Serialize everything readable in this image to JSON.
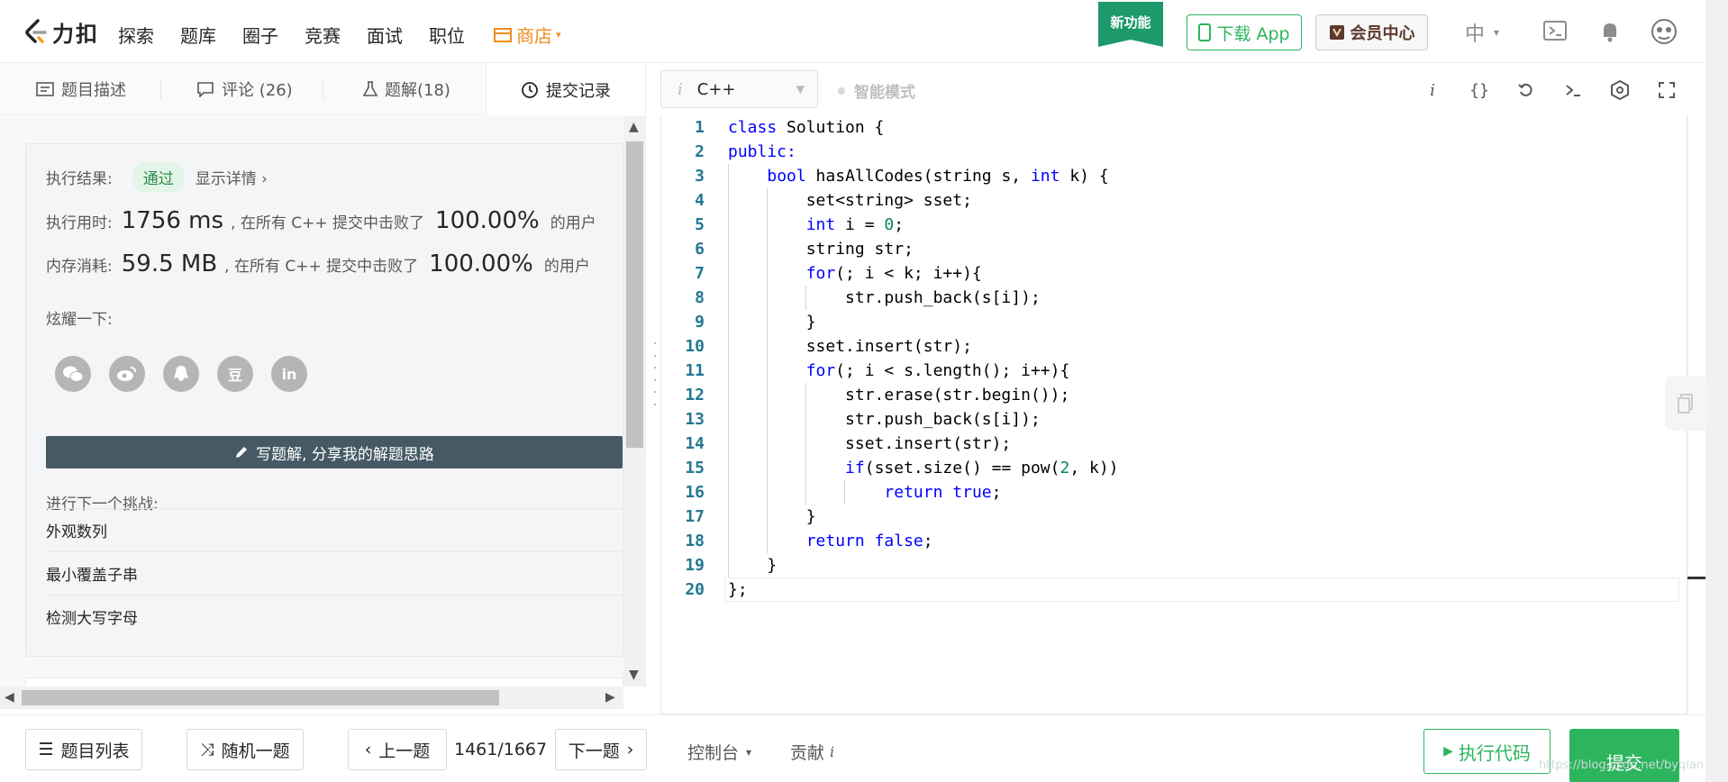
{
  "nav": {
    "logo_text": "力扣",
    "items": [
      "探索",
      "题库",
      "圈子",
      "竞赛",
      "面试",
      "职位"
    ],
    "store": "商店",
    "new_feature": "新功能",
    "download": "下载 App",
    "member": "会员中心",
    "lang": "中"
  },
  "left_tabs": {
    "description": "题目描述",
    "comments": "评论 (26)",
    "solutions": "题解(18)",
    "submissions": "提交记录"
  },
  "result": {
    "status_label": "执行结果:",
    "status": "通过",
    "detail_link": "显示详情 ›",
    "time_label": "执行用时:",
    "time_value": "1756 ms",
    "time_text": ", 在所有 C++ 提交中击败了",
    "time_pct": "100.00%",
    "time_suffix": "的用户",
    "mem_label": "内存消耗:",
    "mem_value": "59.5 MB",
    "mem_text": ", 在所有 C++ 提交中击败了",
    "mem_pct": "100.00%",
    "mem_suffix": "的用户",
    "share_label": "炫耀一下:",
    "share_douban": "豆",
    "share_linkedin": "in",
    "write_solution": "写题解, 分享我的解题思路",
    "next_label": "进行下一个挑战:",
    "next_items": [
      "外观数列",
      "最小覆盖子串",
      "检测大写字母"
    ]
  },
  "editor": {
    "language": "C++",
    "smart_mode": "智能模式",
    "code": [
      [
        [
          "Class ",
          ""
        ]
      ],
      [
        [
          "public:",
          "kw"
        ]
      ],
      [
        [
          "    ",
          ""
        ],
        [
          "bool",
          "kw"
        ],
        [
          " hasAllCodes(string s, ",
          ""
        ],
        [
          "int",
          "kw"
        ],
        [
          " k) {",
          ""
        ]
      ],
      [
        [
          "        set<string> sset;",
          ""
        ]
      ],
      [
        [
          "        ",
          ""
        ],
        [
          "int",
          "kw"
        ],
        [
          " i = ",
          ""
        ],
        [
          "0",
          "num"
        ],
        [
          ";",
          ""
        ]
      ],
      [
        [
          "        string str;",
          ""
        ]
      ],
      [
        [
          "        ",
          ""
        ],
        [
          "for",
          "kw"
        ],
        [
          "(; i < k; i++){",
          ""
        ]
      ],
      [
        [
          "            str.push_back(s[i]);",
          ""
        ]
      ],
      [
        [
          "        }",
          ""
        ]
      ],
      [
        [
          "        sset.insert(str);",
          ""
        ]
      ],
      [
        [
          "        ",
          ""
        ],
        [
          "for",
          "kw"
        ],
        [
          "(; i < s.length(); i++){",
          ""
        ]
      ],
      [
        [
          "            str.erase(str.begin());",
          ""
        ]
      ],
      [
        [
          "            str.push_back(s[i]);",
          ""
        ]
      ],
      [
        [
          "            sset.insert(str);",
          ""
        ]
      ],
      [
        [
          "            ",
          ""
        ],
        [
          "if",
          "kw"
        ],
        [
          "(sset.size() == pow(",
          ""
        ],
        [
          "2",
          "num"
        ],
        [
          ", k))",
          ""
        ]
      ],
      [
        [
          "                ",
          ""
        ],
        [
          "return",
          "kw"
        ],
        [
          " ",
          ""
        ],
        [
          "true",
          "kw"
        ],
        [
          ";",
          ""
        ]
      ],
      [
        [
          "        }",
          ""
        ]
      ],
      [
        [
          "        ",
          ""
        ],
        [
          "return",
          "kw"
        ],
        [
          " ",
          ""
        ],
        [
          "false",
          "kw"
        ],
        [
          ";",
          ""
        ]
      ],
      [
        [
          "    }",
          ""
        ]
      ],
      [
        [
          "};",
          ""
        ]
      ]
    ]
  },
  "bottom": {
    "problem_list": "题目列表",
    "random": "随机一题",
    "prev": "上一题",
    "page": "1461/1667",
    "next": "下一题",
    "console": "控制台",
    "contribute": "贡献",
    "run": "执行代码",
    "submit": "提交",
    "watermark": "https://blog.csdn.net/byqian"
  },
  "colors": {
    "accent": "#2db55d",
    "store": "#f08c1f",
    "new_feature": "#1c9a6c",
    "keyword": "#0000ff",
    "number": "#098658"
  }
}
